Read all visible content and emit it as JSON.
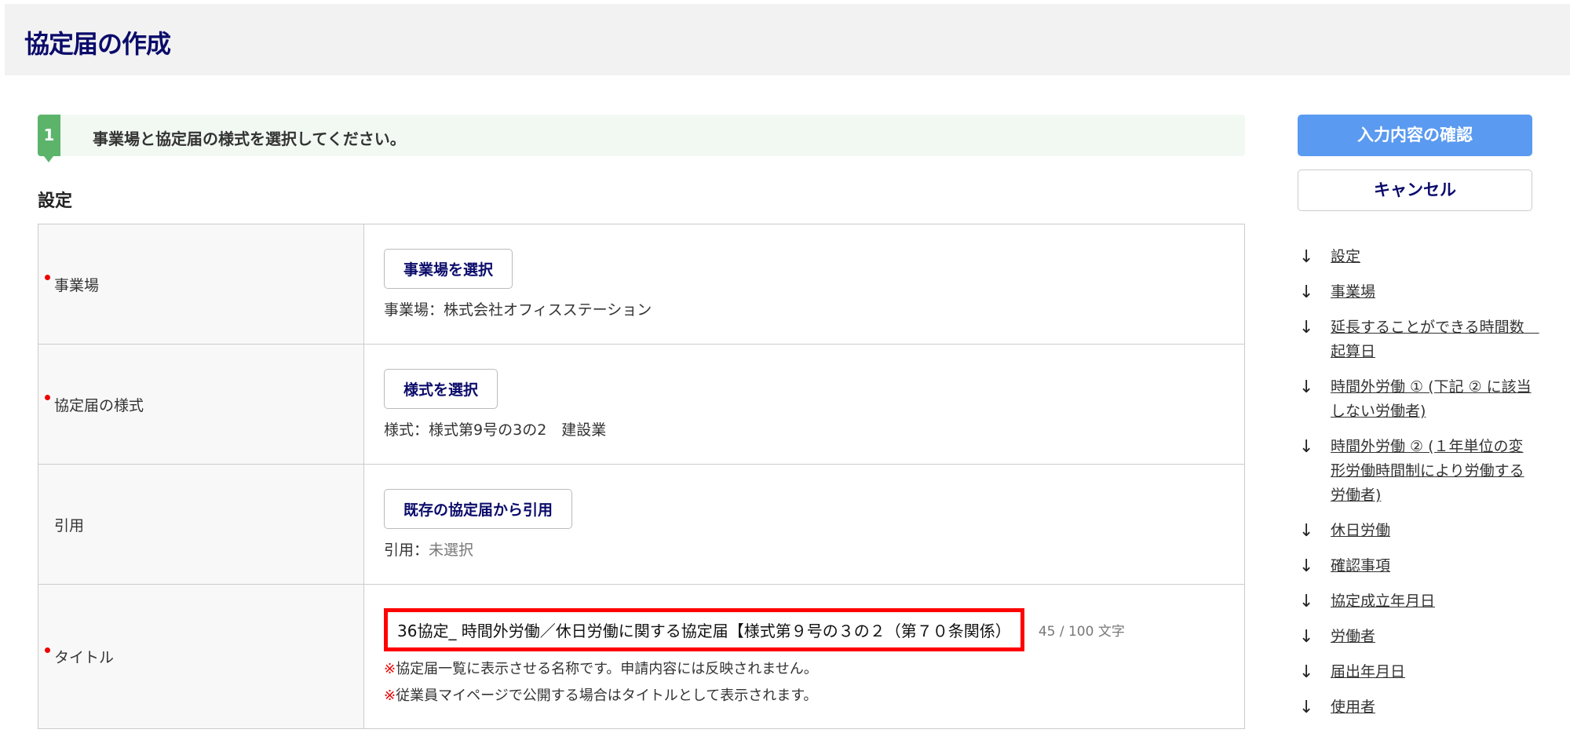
{
  "header": {
    "title": "協定届の作成"
  },
  "step": {
    "number": "1",
    "text": "事業場と協定届の様式を選択してください。"
  },
  "section_title": "設定",
  "rows": [
    {
      "label": "事業場",
      "required": true,
      "button": "事業場を選択",
      "value_label": "事業場：",
      "value": "株式会社オフィスステーション"
    },
    {
      "label": "協定届の様式",
      "required": true,
      "button": "様式を選択",
      "value_label": "様式：",
      "value": "様式第9号の3の2　建設業"
    },
    {
      "label": "引用",
      "required": false,
      "button": "既存の協定届から引用",
      "value_label": "引用：",
      "value": "未選択"
    }
  ],
  "title_row": {
    "label": "タイトル",
    "value": "36協定_ 時間外労働／休日労働に関する協定届【様式第９号の３の２（第７０条関係）",
    "count": "45 / 100 文字",
    "notes": [
      {
        "mark": "※",
        "text": "協定届一覧に表示させる名称です。申請内容には反映されません。"
      },
      {
        "mark": "※",
        "text": "従業員マイページで公開する場合はタイトルとして表示されます。"
      }
    ]
  },
  "actions": {
    "confirm": "入力内容の確認",
    "cancel": "キャンセル"
  },
  "nav": [
    "設定",
    "事業場",
    "延長することができる時間数　起算日",
    "時間外労働 ① (下記 ② に該当しない労働者)",
    "時間外労働 ② (１年単位の変形労働時間制により労働する労働者)",
    "休日労働",
    "確認事項",
    "協定成立年月日",
    "労働者",
    "届出年月日",
    "使用者"
  ],
  "colors": {
    "accent": "#5a9af0",
    "required": "#ee0000",
    "step": "#5cb46b",
    "title": "#0b0b6b"
  }
}
